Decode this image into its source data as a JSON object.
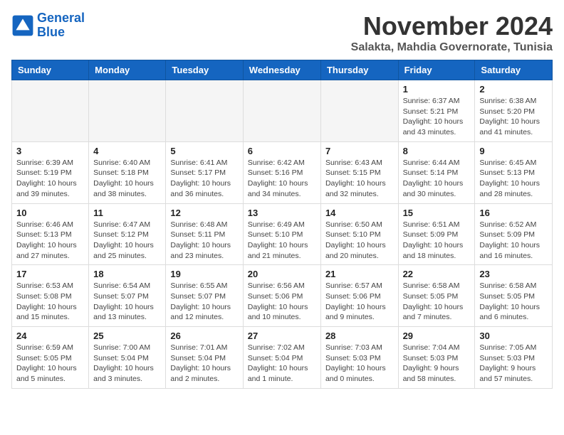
{
  "logo": {
    "line1": "General",
    "line2": "Blue"
  },
  "title": "November 2024",
  "location": "Salakta, Mahdia Governorate, Tunisia",
  "days_of_week": [
    "Sunday",
    "Monday",
    "Tuesday",
    "Wednesday",
    "Thursday",
    "Friday",
    "Saturday"
  ],
  "weeks": [
    [
      {
        "day": "",
        "detail": ""
      },
      {
        "day": "",
        "detail": ""
      },
      {
        "day": "",
        "detail": ""
      },
      {
        "day": "",
        "detail": ""
      },
      {
        "day": "",
        "detail": ""
      },
      {
        "day": "1",
        "detail": "Sunrise: 6:37 AM\nSunset: 5:21 PM\nDaylight: 10 hours and 43 minutes."
      },
      {
        "day": "2",
        "detail": "Sunrise: 6:38 AM\nSunset: 5:20 PM\nDaylight: 10 hours and 41 minutes."
      }
    ],
    [
      {
        "day": "3",
        "detail": "Sunrise: 6:39 AM\nSunset: 5:19 PM\nDaylight: 10 hours and 39 minutes."
      },
      {
        "day": "4",
        "detail": "Sunrise: 6:40 AM\nSunset: 5:18 PM\nDaylight: 10 hours and 38 minutes."
      },
      {
        "day": "5",
        "detail": "Sunrise: 6:41 AM\nSunset: 5:17 PM\nDaylight: 10 hours and 36 minutes."
      },
      {
        "day": "6",
        "detail": "Sunrise: 6:42 AM\nSunset: 5:16 PM\nDaylight: 10 hours and 34 minutes."
      },
      {
        "day": "7",
        "detail": "Sunrise: 6:43 AM\nSunset: 5:15 PM\nDaylight: 10 hours and 32 minutes."
      },
      {
        "day": "8",
        "detail": "Sunrise: 6:44 AM\nSunset: 5:14 PM\nDaylight: 10 hours and 30 minutes."
      },
      {
        "day": "9",
        "detail": "Sunrise: 6:45 AM\nSunset: 5:13 PM\nDaylight: 10 hours and 28 minutes."
      }
    ],
    [
      {
        "day": "10",
        "detail": "Sunrise: 6:46 AM\nSunset: 5:13 PM\nDaylight: 10 hours and 27 minutes."
      },
      {
        "day": "11",
        "detail": "Sunrise: 6:47 AM\nSunset: 5:12 PM\nDaylight: 10 hours and 25 minutes."
      },
      {
        "day": "12",
        "detail": "Sunrise: 6:48 AM\nSunset: 5:11 PM\nDaylight: 10 hours and 23 minutes."
      },
      {
        "day": "13",
        "detail": "Sunrise: 6:49 AM\nSunset: 5:10 PM\nDaylight: 10 hours and 21 minutes."
      },
      {
        "day": "14",
        "detail": "Sunrise: 6:50 AM\nSunset: 5:10 PM\nDaylight: 10 hours and 20 minutes."
      },
      {
        "day": "15",
        "detail": "Sunrise: 6:51 AM\nSunset: 5:09 PM\nDaylight: 10 hours and 18 minutes."
      },
      {
        "day": "16",
        "detail": "Sunrise: 6:52 AM\nSunset: 5:09 PM\nDaylight: 10 hours and 16 minutes."
      }
    ],
    [
      {
        "day": "17",
        "detail": "Sunrise: 6:53 AM\nSunset: 5:08 PM\nDaylight: 10 hours and 15 minutes."
      },
      {
        "day": "18",
        "detail": "Sunrise: 6:54 AM\nSunset: 5:07 PM\nDaylight: 10 hours and 13 minutes."
      },
      {
        "day": "19",
        "detail": "Sunrise: 6:55 AM\nSunset: 5:07 PM\nDaylight: 10 hours and 12 minutes."
      },
      {
        "day": "20",
        "detail": "Sunrise: 6:56 AM\nSunset: 5:06 PM\nDaylight: 10 hours and 10 minutes."
      },
      {
        "day": "21",
        "detail": "Sunrise: 6:57 AM\nSunset: 5:06 PM\nDaylight: 10 hours and 9 minutes."
      },
      {
        "day": "22",
        "detail": "Sunrise: 6:58 AM\nSunset: 5:05 PM\nDaylight: 10 hours and 7 minutes."
      },
      {
        "day": "23",
        "detail": "Sunrise: 6:58 AM\nSunset: 5:05 PM\nDaylight: 10 hours and 6 minutes."
      }
    ],
    [
      {
        "day": "24",
        "detail": "Sunrise: 6:59 AM\nSunset: 5:05 PM\nDaylight: 10 hours and 5 minutes."
      },
      {
        "day": "25",
        "detail": "Sunrise: 7:00 AM\nSunset: 5:04 PM\nDaylight: 10 hours and 3 minutes."
      },
      {
        "day": "26",
        "detail": "Sunrise: 7:01 AM\nSunset: 5:04 PM\nDaylight: 10 hours and 2 minutes."
      },
      {
        "day": "27",
        "detail": "Sunrise: 7:02 AM\nSunset: 5:04 PM\nDaylight: 10 hours and 1 minute."
      },
      {
        "day": "28",
        "detail": "Sunrise: 7:03 AM\nSunset: 5:03 PM\nDaylight: 10 hours and 0 minutes."
      },
      {
        "day": "29",
        "detail": "Sunrise: 7:04 AM\nSunset: 5:03 PM\nDaylight: 9 hours and 58 minutes."
      },
      {
        "day": "30",
        "detail": "Sunrise: 7:05 AM\nSunset: 5:03 PM\nDaylight: 9 hours and 57 minutes."
      }
    ]
  ]
}
